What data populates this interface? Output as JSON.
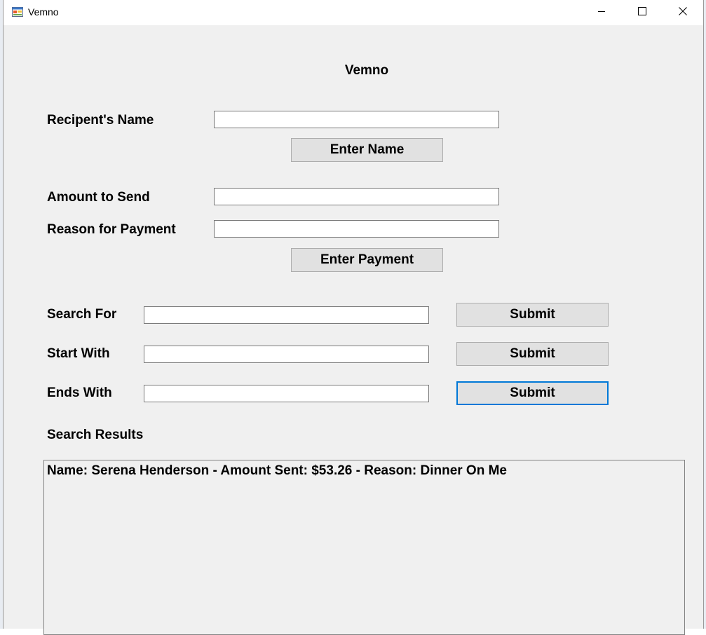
{
  "window": {
    "title": "Vemno"
  },
  "form": {
    "heading": "Vemno",
    "recipient_label": "Recipent's Name",
    "recipient_value": "",
    "enter_name_label": "Enter Name",
    "amount_label": "Amount to Send",
    "amount_value": "",
    "reason_label": "Reason for Payment",
    "reason_value": "",
    "enter_payment_label": "Enter Payment",
    "search_for_label": "Search For",
    "search_for_value": "",
    "start_with_label": "Start With",
    "start_with_value": "",
    "ends_with_label": "Ends With",
    "ends_with_value": "",
    "submit_label": "Submit",
    "results_label": "Search Results"
  },
  "results": {
    "items": [
      "Name: Serena Henderson - Amount Sent: $53.26 - Reason: Dinner On Me"
    ]
  },
  "icons": {
    "app": "app-window-icon",
    "minimize": "minimize-icon",
    "maximize": "maximize-icon",
    "close": "close-icon"
  },
  "colors": {
    "window_bg": "#f0f0f0",
    "button_bg": "#e1e1e1",
    "focus_border": "#0078d7"
  }
}
